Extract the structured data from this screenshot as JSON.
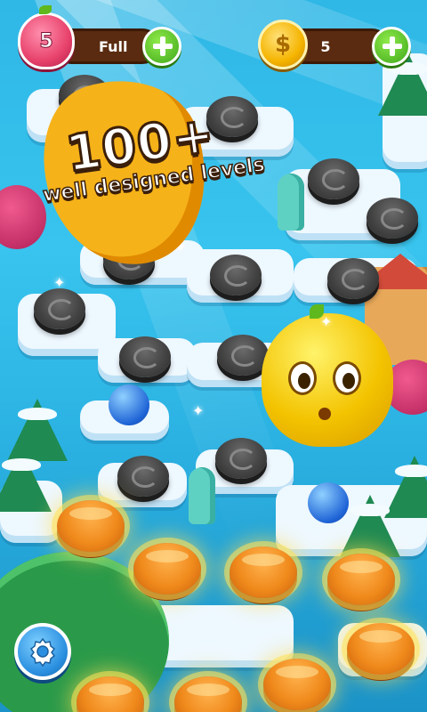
{
  "hud": {
    "lives_count": "5",
    "lives_status": "Full",
    "coins_count": "5",
    "colors": {
      "pill": "#5a2b10",
      "plus": "#3fa81a",
      "coin": "#f5b400",
      "heart": "#e8436c"
    }
  },
  "promo": {
    "headline": "100+",
    "subline": "well designed levels"
  },
  "settings": {
    "icon": "gear-icon"
  }
}
